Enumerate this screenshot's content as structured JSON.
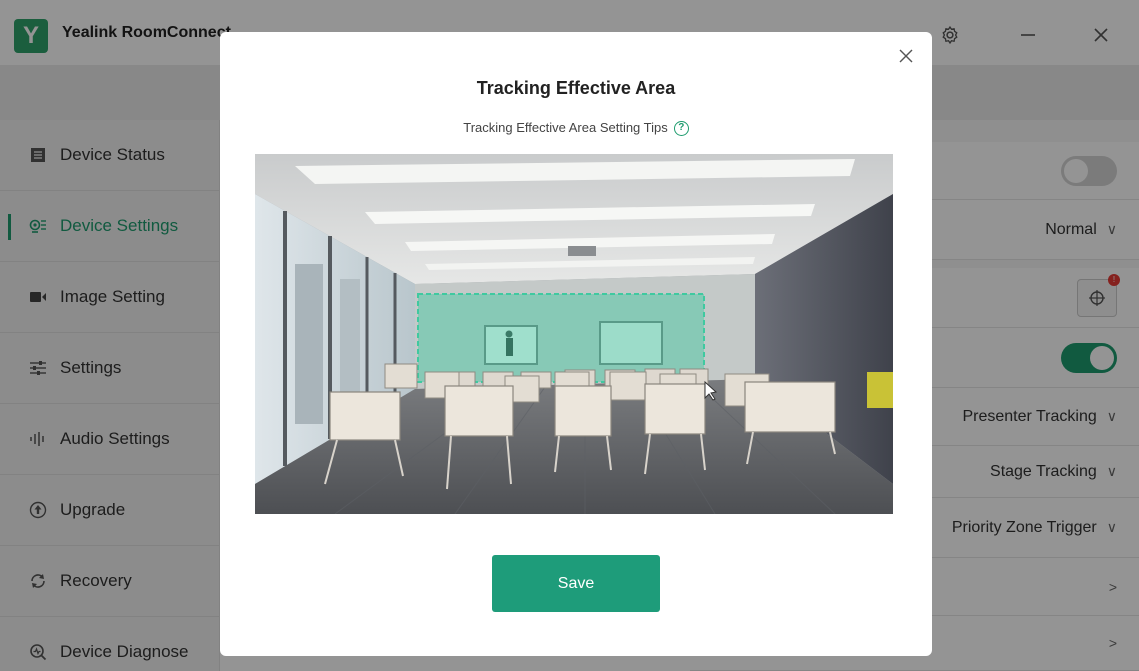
{
  "app": {
    "title": "Yealink RoomConnect",
    "logo_letter": "Y",
    "accent": "#1e9c6e"
  },
  "titlebar": {
    "icons": [
      "gear-icon",
      "minimize-icon",
      "close-icon"
    ]
  },
  "sidebar": {
    "items": [
      {
        "label": "Device Status",
        "icon": "list-icon"
      },
      {
        "label": "Device Settings",
        "icon": "camera-settings-icon",
        "active": true
      },
      {
        "label": "Image Setting",
        "icon": "video-icon"
      },
      {
        "label": "Settings",
        "icon": "sliders-icon"
      },
      {
        "label": "Audio Settings",
        "icon": "audio-bars-icon"
      },
      {
        "label": "Upgrade",
        "icon": "upgrade-icon"
      },
      {
        "label": "Recovery",
        "icon": "recovery-icon"
      },
      {
        "label": "Device Diagnose",
        "icon": "diagnose-icon"
      }
    ]
  },
  "panel": {
    "rows": [
      {
        "type": "toggle",
        "state": "off"
      },
      {
        "type": "dropdown",
        "value": "Normal"
      },
      {
        "type": "target-button"
      },
      {
        "type": "toggle",
        "state": "on"
      },
      {
        "type": "dropdown",
        "value": "Presenter Tracking"
      },
      {
        "type": "dropdown",
        "value": "Stage Tracking"
      },
      {
        "type": "dropdown",
        "value": "Priority Zone Trigger"
      },
      {
        "type": "arrow"
      },
      {
        "type": "arrow"
      }
    ]
  },
  "modal": {
    "title": "Tracking Effective Area",
    "tips": "Tracking Effective Area Setting Tips",
    "help_glyph": "?",
    "save_label": "Save",
    "highlight_color": "#3fc9a0"
  }
}
